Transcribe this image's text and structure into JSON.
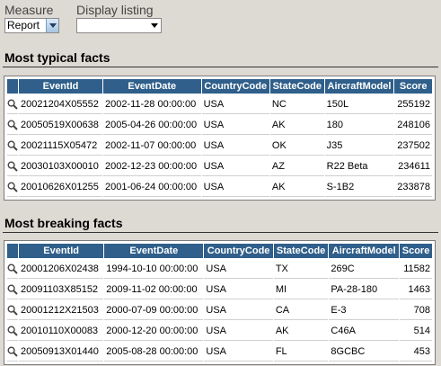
{
  "controls": {
    "measure_label": "Measure",
    "measure_value": "Report",
    "display_label": "Display listing",
    "display_value": ""
  },
  "colors": {
    "header_bg": "#2f5f8a",
    "page_bg": "#ddd9d3"
  },
  "typical": {
    "title": "Most typical facts",
    "headers": [
      "",
      "EventId",
      "EventDate",
      "CountryCode",
      "StateCode",
      "AircraftModel",
      "Score"
    ],
    "rows": [
      [
        "20021204X05552",
        "2002-11-28 00:00:00",
        "USA",
        "NC",
        "150L",
        "255192"
      ],
      [
        "20050519X00638",
        "2005-04-26 00:00:00",
        "USA",
        "AK",
        "180",
        "248106"
      ],
      [
        "20021115X05472",
        "2002-11-07 00:00:00",
        "USA",
        "OK",
        "J35",
        "237502"
      ],
      [
        "20030103X00010",
        "2002-12-23 00:00:00",
        "USA",
        "AZ",
        "R22 Beta",
        "234611"
      ],
      [
        "20010626X01255",
        "2001-06-24 00:00:00",
        "USA",
        "AK",
        "S-1B2",
        "233878"
      ]
    ]
  },
  "breaking": {
    "title": "Most breaking facts",
    "headers": [
      "",
      "EventId",
      "EventDate",
      "CountryCode",
      "StateCode",
      "AircraftModel",
      "Score"
    ],
    "rows": [
      [
        "20001206X02438",
        "1994-10-10 00:00:00",
        "USA",
        "TX",
        "269C",
        "11582"
      ],
      [
        "20091103X85152",
        "2009-11-02 00:00:00",
        "USA",
        "MI",
        "PA-28-180",
        "1463"
      ],
      [
        "20001212X21503",
        "2000-07-09 00:00:00",
        "USA",
        "CA",
        "E-3",
        "708"
      ],
      [
        "20010110X00083",
        "2000-12-20 00:00:00",
        "USA",
        "AK",
        "C46A",
        "514"
      ],
      [
        "20050913X01440",
        "2005-08-28 00:00:00",
        "USA",
        "FL",
        "8GCBC",
        "453"
      ]
    ]
  },
  "icons": {
    "row_detail": "magnifier-icon",
    "dropdown": "chevron-down-icon"
  }
}
